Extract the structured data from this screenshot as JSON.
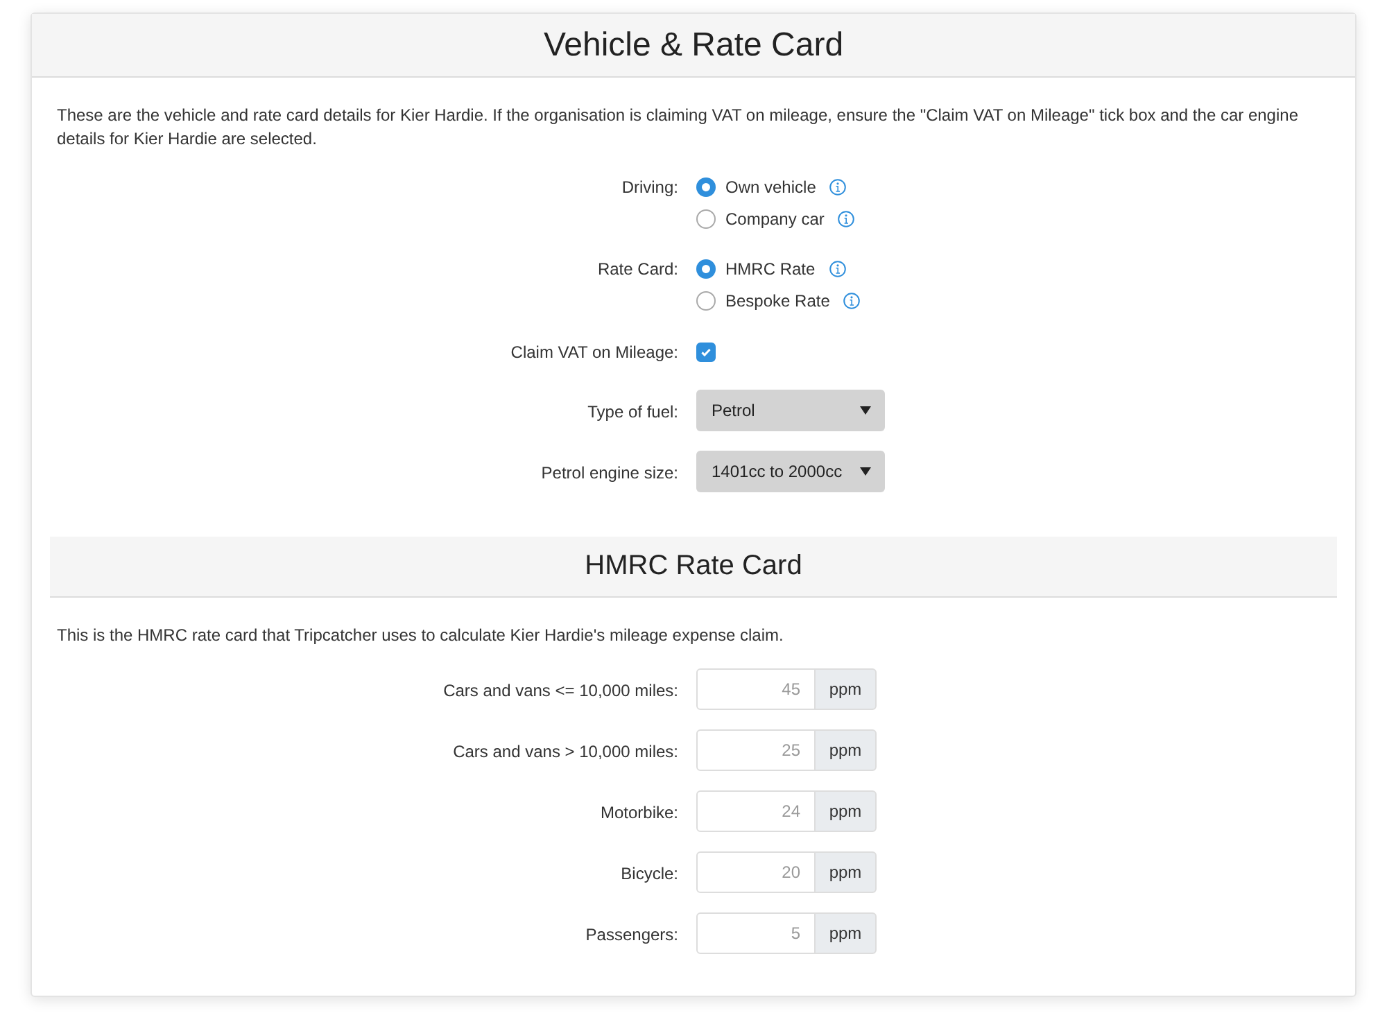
{
  "vehicle_card": {
    "title": "Vehicle & Rate Card",
    "description": "These are the vehicle and rate card details for Kier Hardie. If the organisation is claiming VAT on mileage, ensure the \"Claim VAT on Mileage\" tick box and the car engine details for Kier Hardie are selected.",
    "fields": [
      {
        "kind": "radio",
        "label": "Driving:",
        "options": [
          {
            "label": "Own vehicle",
            "selected": true
          },
          {
            "label": "Company car",
            "selected": false
          }
        ]
      },
      {
        "kind": "radio",
        "label": "Rate Card:",
        "options": [
          {
            "label": "HMRC Rate",
            "selected": true
          },
          {
            "label": "Bespoke Rate",
            "selected": false
          }
        ]
      },
      {
        "kind": "checkbox",
        "label": "Claim VAT on Mileage:",
        "checked": true
      },
      {
        "kind": "select",
        "label": "Type of fuel:",
        "value": "Petrol"
      },
      {
        "kind": "select",
        "label": "Petrol engine size:",
        "value": "1401cc to 2000cc"
      }
    ]
  },
  "rate_card": {
    "title": "HMRC Rate Card",
    "description": "This is the HMRC rate card that Tripcatcher uses to calculate Kier Hardie's mileage expense claim.",
    "rates": [
      {
        "label": "Cars and vans <= 10,000 miles:",
        "value": "45",
        "unit": "ppm",
        "disabled": true
      },
      {
        "label": "Cars and vans > 10,000 miles:",
        "value": "25",
        "unit": "ppm",
        "disabled": true
      },
      {
        "label": "Motorbike:",
        "value": "24",
        "unit": "ppm",
        "disabled": true
      },
      {
        "label": "Bicycle:",
        "value": "20",
        "unit": "ppm",
        "disabled": true
      },
      {
        "label": "Passengers:",
        "value": "5",
        "unit": "ppm",
        "disabled": true
      }
    ]
  }
}
